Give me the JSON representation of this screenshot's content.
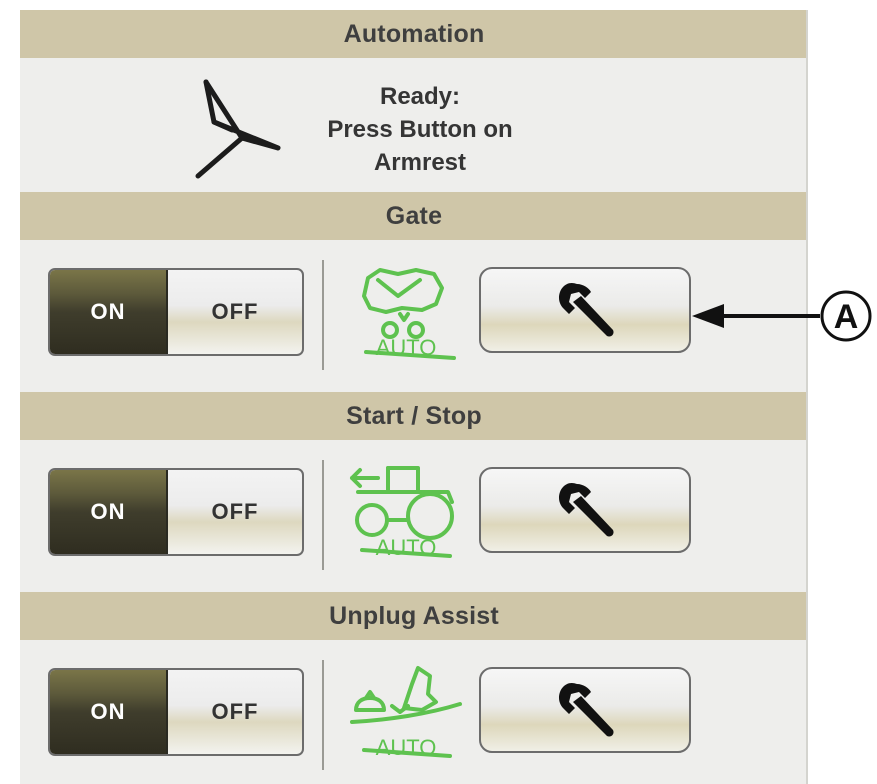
{
  "panel": {
    "automation_header": "Automation",
    "ready_status": [
      "Ready:",
      "Press Button on",
      "Armrest"
    ],
    "sections": [
      {
        "title": "Gate",
        "toggle_on": "ON",
        "toggle_off": "OFF",
        "auto_label": "AUTO",
        "icon": "gate-auto-icon"
      },
      {
        "title": "Start / Stop",
        "toggle_on": "ON",
        "toggle_off": "OFF",
        "auto_label": "AUTO",
        "icon": "tractor-auto-icon"
      },
      {
        "title": "Unplug Assist",
        "toggle_on": "ON",
        "toggle_off": "OFF",
        "auto_label": "AUTO",
        "icon": "unplug-auto-icon"
      }
    ]
  },
  "callout": {
    "label": "A"
  },
  "colors": {
    "header_bg": "#cfc6a8",
    "panel_bg": "#eeeeec",
    "auto_icon_green": "#5ec24f",
    "toggle_on_bg": "#3f3d2c"
  }
}
